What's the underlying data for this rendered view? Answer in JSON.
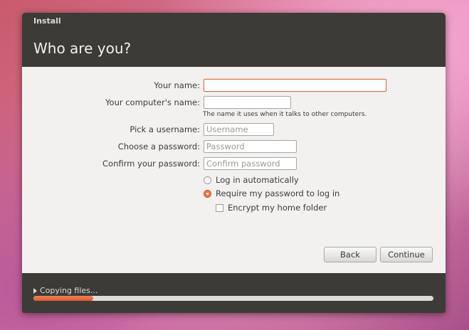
{
  "window": {
    "title": "Install",
    "heading": "Who are you?"
  },
  "form": {
    "name": {
      "label": "Your name:",
      "value": "",
      "placeholder": ""
    },
    "computer": {
      "label": "Your computer's name:",
      "value": "",
      "placeholder": "",
      "hint": "The name it uses when it talks to other computers."
    },
    "username": {
      "label": "Pick a username:",
      "value": "",
      "placeholder": "Username"
    },
    "password": {
      "label": "Choose a password:",
      "value": "",
      "placeholder": "Password"
    },
    "confirm": {
      "label": "Confirm your password:",
      "value": "",
      "placeholder": "Confirm password"
    },
    "login_options": [
      {
        "label": "Log in automatically",
        "checked": false
      },
      {
        "label": "Require my password to log in",
        "checked": true
      }
    ],
    "encrypt": {
      "label": "Encrypt my home folder",
      "checked": false
    }
  },
  "buttons": {
    "back": "Back",
    "continue": "Continue"
  },
  "status": {
    "text": "Copying files...",
    "progress": 0.15
  },
  "colors": {
    "accent": "#dd5a2c",
    "titlebar": "#3c3b37",
    "content_bg": "#f2f1f0"
  },
  "icons": {
    "status_expander": "triangle-right-icon"
  }
}
